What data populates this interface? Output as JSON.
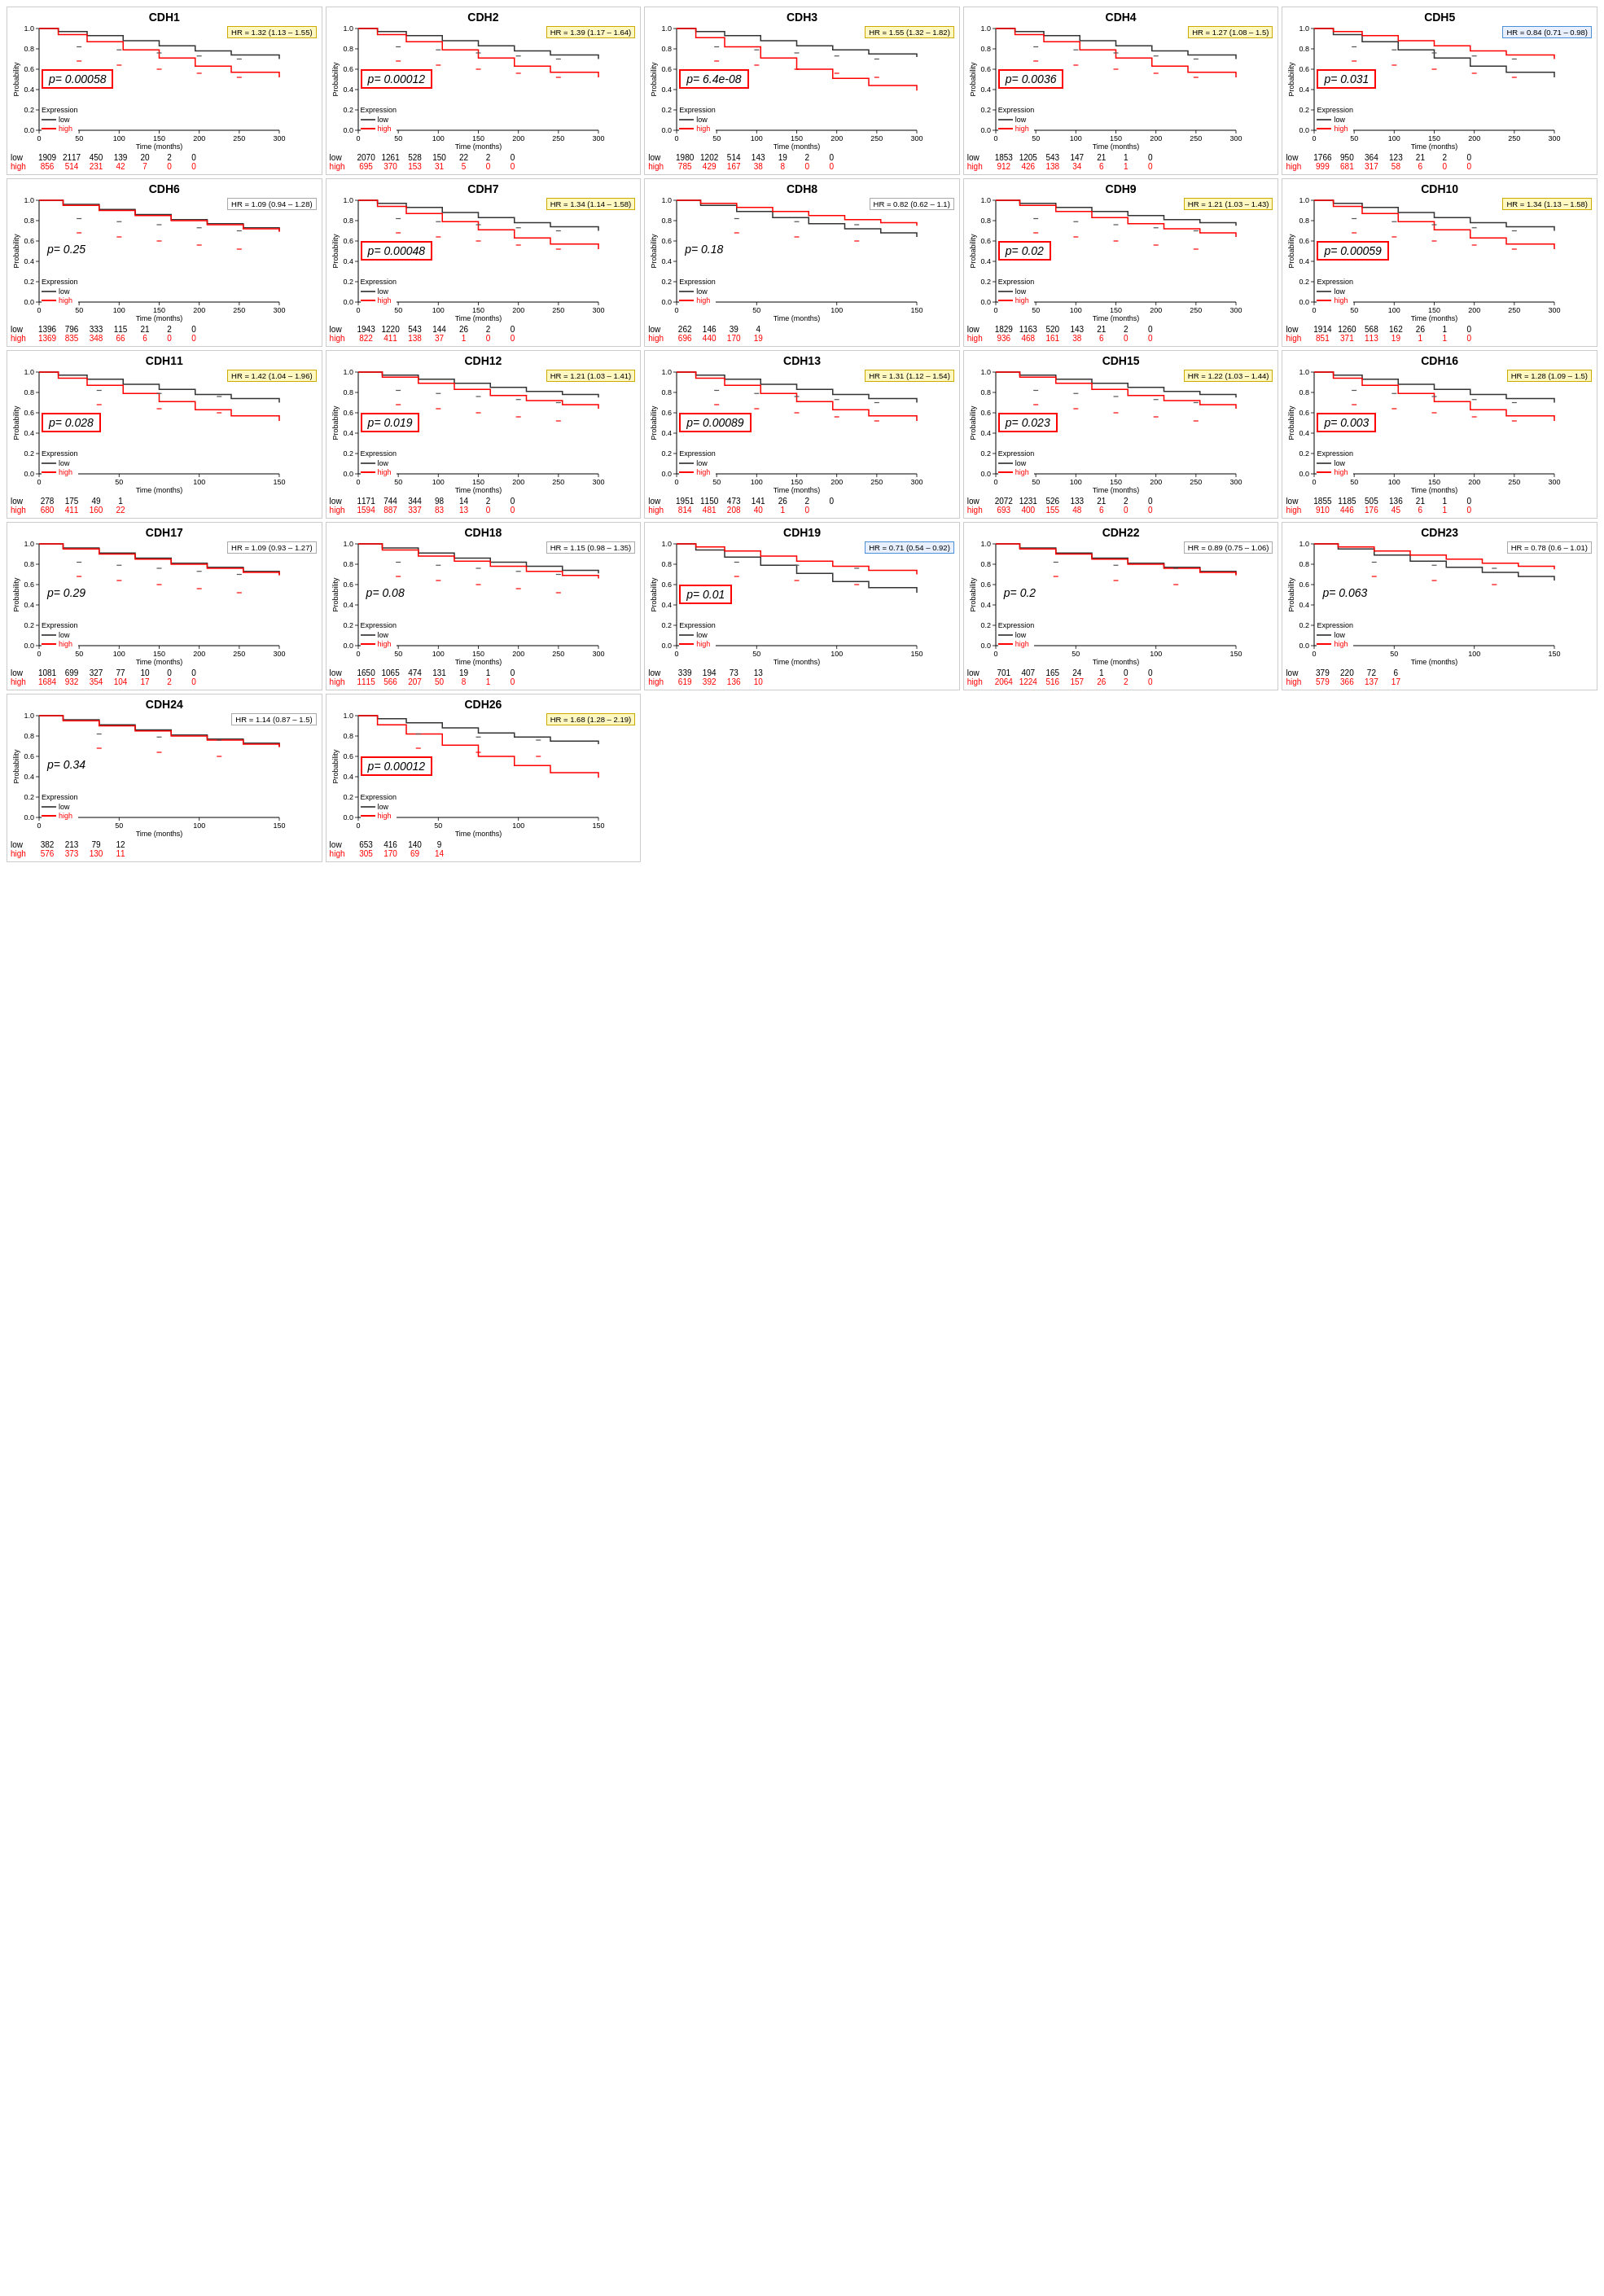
{
  "charts": [
    {
      "id": "CDH1",
      "title": "CDH1",
      "hr": "HR = 1.32 (1.13 – 1.55)",
      "hr_style": "yellow",
      "pvalue": "p= 0.00058",
      "pbox_style": "red",
      "low_data": [
        "1909",
        "2117",
        "450",
        "139",
        "20",
        "2",
        "0"
      ],
      "high_data": [
        "856",
        "514",
        "231",
        "42",
        "7",
        "0",
        "0"
      ],
      "time_max": "300",
      "curve_type": "diverge_high"
    },
    {
      "id": "CDH2",
      "title": "CDH2",
      "hr": "HR = 1.39 (1.17 – 1.64)",
      "hr_style": "yellow",
      "pvalue": "p= 0.00012",
      "pbox_style": "red",
      "low_data": [
        "2070",
        "1261",
        "528",
        "150",
        "22",
        "2",
        "0"
      ],
      "high_data": [
        "695",
        "370",
        "153",
        "31",
        "5",
        "0",
        "0"
      ],
      "time_max": "300",
      "curve_type": "diverge_high"
    },
    {
      "id": "CDH3",
      "title": "CDH3",
      "hr": "HR = 1.55 (1.32 – 1.82)",
      "hr_style": "yellow",
      "pvalue": "p= 6.4e-08",
      "pbox_style": "red",
      "low_data": [
        "1980",
        "1202",
        "514",
        "143",
        "19",
        "2",
        "0"
      ],
      "high_data": [
        "785",
        "429",
        "167",
        "38",
        "8",
        "0",
        "0"
      ],
      "time_max": "300",
      "curve_type": "diverge_high_strong"
    },
    {
      "id": "CDH4",
      "title": "CDH4",
      "hr": "HR = 1.27 (1.08 – 1.5)",
      "hr_style": "yellow",
      "pvalue": "p= 0.0036",
      "pbox_style": "red",
      "low_data": [
        "1853",
        "1205",
        "543",
        "147",
        "21",
        "1",
        "0"
      ],
      "high_data": [
        "912",
        "426",
        "138",
        "34",
        "6",
        "1",
        "0"
      ],
      "time_max": "300",
      "curve_type": "diverge_high"
    },
    {
      "id": "CDH5",
      "title": "CDH5",
      "hr": "HR = 0.84 (0.71 – 0.98)",
      "hr_style": "blue",
      "pvalue": "p= 0.031",
      "pbox_style": "red",
      "low_data": [
        "1766",
        "950",
        "364",
        "123",
        "21",
        "2",
        "0"
      ],
      "high_data": [
        "999",
        "681",
        "317",
        "58",
        "6",
        "0",
        "0"
      ],
      "time_max": "300",
      "curve_type": "diverge_low"
    },
    {
      "id": "CDH6",
      "title": "CDH6",
      "hr": "HR = 1.09 (0.94 – 1.28)",
      "hr_style": "gray",
      "pvalue": "p= 0.25",
      "pbox_style": "plain",
      "low_data": [
        "1396",
        "796",
        "333",
        "115",
        "21",
        "2",
        "0"
      ],
      "high_data": [
        "1369",
        "835",
        "348",
        "66",
        "6",
        "0",
        "0"
      ],
      "time_max": "300",
      "curve_type": "similar"
    },
    {
      "id": "CDH7",
      "title": "CDH7",
      "hr": "HR = 1.34 (1.14 – 1.58)",
      "hr_style": "yellow",
      "pvalue": "p= 0.00048",
      "pbox_style": "red",
      "low_data": [
        "1943",
        "1220",
        "543",
        "144",
        "26",
        "2",
        "0"
      ],
      "high_data": [
        "822",
        "411",
        "138",
        "37",
        "1",
        "0",
        "0"
      ],
      "time_max": "300",
      "curve_type": "diverge_high"
    },
    {
      "id": "CDH8",
      "title": "CDH8",
      "hr": "HR = 0.82 (0.62 – 1.1)",
      "hr_style": "gray",
      "pvalue": "p= 0.18",
      "pbox_style": "plain",
      "low_data": [
        "262",
        "146",
        "39",
        "4",
        "",
        "",
        ""
      ],
      "high_data": [
        "696",
        "440",
        "170",
        "19",
        "",
        "",
        ""
      ],
      "time_max": "150",
      "curve_type": "diverge_low_slight"
    },
    {
      "id": "CDH9",
      "title": "CDH9",
      "hr": "HR = 1.21 (1.03 – 1.43)",
      "hr_style": "yellow",
      "pvalue": "p= 0.02",
      "pbox_style": "red",
      "low_data": [
        "1829",
        "1163",
        "520",
        "143",
        "21",
        "2",
        "0"
      ],
      "high_data": [
        "936",
        "468",
        "161",
        "38",
        "6",
        "0",
        "0"
      ],
      "time_max": "300",
      "curve_type": "diverge_high_slight"
    },
    {
      "id": "CDH10",
      "title": "CDH10",
      "hr": "HR = 1.34 (1.13 – 1.58)",
      "hr_style": "yellow",
      "pvalue": "p= 0.00059",
      "pbox_style": "red",
      "low_data": [
        "1914",
        "1260",
        "568",
        "162",
        "26",
        "1",
        "0"
      ],
      "high_data": [
        "851",
        "371",
        "113",
        "19",
        "1",
        "1",
        "0"
      ],
      "time_max": "300",
      "curve_type": "diverge_high"
    },
    {
      "id": "CDH11",
      "title": "CDH11",
      "hr": "HR = 1.42 (1.04 – 1.96)",
      "hr_style": "yellow",
      "pvalue": "p= 0.028",
      "pbox_style": "red",
      "low_data": [
        "278",
        "175",
        "49",
        "1",
        "",
        "",
        ""
      ],
      "high_data": [
        "680",
        "411",
        "160",
        "22",
        "",
        "",
        ""
      ],
      "time_max": "150",
      "curve_type": "diverge_high"
    },
    {
      "id": "CDH12",
      "title": "CDH12",
      "hr": "HR = 1.21 (1.03 – 1.41)",
      "hr_style": "yellow",
      "pvalue": "p= 0.019",
      "pbox_style": "red",
      "low_data": [
        "1171",
        "744",
        "344",
        "98",
        "14",
        "2",
        "0"
      ],
      "high_data": [
        "1594",
        "887",
        "337",
        "83",
        "13",
        "0",
        "0"
      ],
      "time_max": "300",
      "curve_type": "diverge_high_slight"
    },
    {
      "id": "CDH13",
      "title": "CDH13",
      "hr": "HR = 1.31 (1.12 – 1.54)",
      "hr_style": "yellow",
      "pvalue": "p= 0.00089",
      "pbox_style": "red",
      "low_data": [
        "1951",
        "1150",
        "473",
        "141",
        "26",
        "2",
        "0"
      ],
      "high_data": [
        "814",
        "481",
        "208",
        "40",
        "1",
        "0",
        ""
      ],
      "time_max": "300",
      "curve_type": "diverge_high"
    },
    {
      "id": "CDH15",
      "title": "CDH15",
      "hr": "HR = 1.22 (1.03 – 1.44)",
      "hr_style": "yellow",
      "pvalue": "p= 0.023",
      "pbox_style": "red",
      "low_data": [
        "2072",
        "1231",
        "526",
        "133",
        "21",
        "2",
        "0"
      ],
      "high_data": [
        "693",
        "400",
        "155",
        "48",
        "6",
        "0",
        "0"
      ],
      "time_max": "300",
      "curve_type": "diverge_high_slight"
    },
    {
      "id": "CDH16",
      "title": "CDH16",
      "hr": "HR = 1.28 (1.09 – 1.5)",
      "hr_style": "yellow",
      "pvalue": "p= 0.003",
      "pbox_style": "red",
      "low_data": [
        "1855",
        "1185",
        "505",
        "136",
        "21",
        "1",
        "0"
      ],
      "high_data": [
        "910",
        "446",
        "176",
        "45",
        "6",
        "1",
        "0"
      ],
      "time_max": "300",
      "curve_type": "diverge_high"
    },
    {
      "id": "CDH17",
      "title": "CDH17",
      "hr": "HR = 1.09 (0.93 – 1.27)",
      "hr_style": "gray",
      "pvalue": "p= 0.29",
      "pbox_style": "plain",
      "low_data": [
        "1081",
        "699",
        "327",
        "77",
        "10",
        "0",
        "0"
      ],
      "high_data": [
        "1684",
        "932",
        "354",
        "104",
        "17",
        "2",
        "0"
      ],
      "time_max": "300",
      "curve_type": "similar"
    },
    {
      "id": "CDH18",
      "title": "CDH18",
      "hr": "HR = 1.15 (0.98 – 1.35)",
      "hr_style": "gray",
      "pvalue": "p= 0.08",
      "pbox_style": "plain",
      "low_data": [
        "1650",
        "1065",
        "474",
        "131",
        "19",
        "1",
        "0"
      ],
      "high_data": [
        "1115",
        "566",
        "207",
        "50",
        "8",
        "1",
        "0"
      ],
      "time_max": "300",
      "curve_type": "similar_slight"
    },
    {
      "id": "CDH19",
      "title": "CDH19",
      "hr": "HR = 0.71 (0.54 – 0.92)",
      "hr_style": "blue",
      "pvalue": "p= 0.01",
      "pbox_style": "red",
      "low_data": [
        "339",
        "194",
        "73",
        "13",
        "",
        "",
        ""
      ],
      "high_data": [
        "619",
        "392",
        "136",
        "10",
        "",
        "",
        ""
      ],
      "time_max": "150",
      "curve_type": "diverge_low"
    },
    {
      "id": "CDH22",
      "title": "CDH22",
      "hr": "HR = 0.89 (0.75 – 1.06)",
      "hr_style": "gray",
      "pvalue": "p= 0.2",
      "pbox_style": "plain",
      "low_data": [
        "701",
        "407",
        "165",
        "24",
        "1",
        "0",
        "0"
      ],
      "high_data": [
        "2064",
        "1224",
        "516",
        "157",
        "26",
        "2",
        "0"
      ],
      "time_max": "150",
      "curve_type": "similar"
    },
    {
      "id": "CDH23",
      "title": "CDH23",
      "hr": "HR = 0.78 (0.6 – 1.01)",
      "hr_style": "gray",
      "pvalue": "p= 0.063",
      "pbox_style": "plain",
      "low_data": [
        "379",
        "220",
        "72",
        "6",
        "",
        "",
        ""
      ],
      "high_data": [
        "579",
        "366",
        "137",
        "17",
        "",
        "",
        ""
      ],
      "time_max": "150",
      "curve_type": "diverge_low_slight"
    },
    {
      "id": "CDH24",
      "title": "CDH24",
      "hr": "HR = 1.14 (0.87 – 1.5)",
      "hr_style": "gray",
      "pvalue": "p= 0.34",
      "pbox_style": "plain",
      "low_data": [
        "382",
        "213",
        "79",
        "12",
        "",
        "",
        ""
      ],
      "high_data": [
        "576",
        "373",
        "130",
        "11",
        "",
        "",
        ""
      ],
      "time_max": "150",
      "curve_type": "similar"
    },
    {
      "id": "CDH26",
      "title": "CDH26",
      "hr": "HR = 1.68 (1.28 – 2.19)",
      "hr_style": "yellow",
      "pvalue": "p= 0.00012",
      "pbox_style": "red",
      "low_data": [
        "653",
        "416",
        "140",
        "9",
        "",
        "",
        ""
      ],
      "high_data": [
        "305",
        "170",
        "69",
        "14",
        "",
        "",
        ""
      ],
      "time_max": "150",
      "curve_type": "diverge_high_strong"
    }
  ],
  "labels": {
    "expression": "Expression",
    "low": "low",
    "high": "high",
    "time_months": "Time (months)",
    "probability": "Probability"
  }
}
